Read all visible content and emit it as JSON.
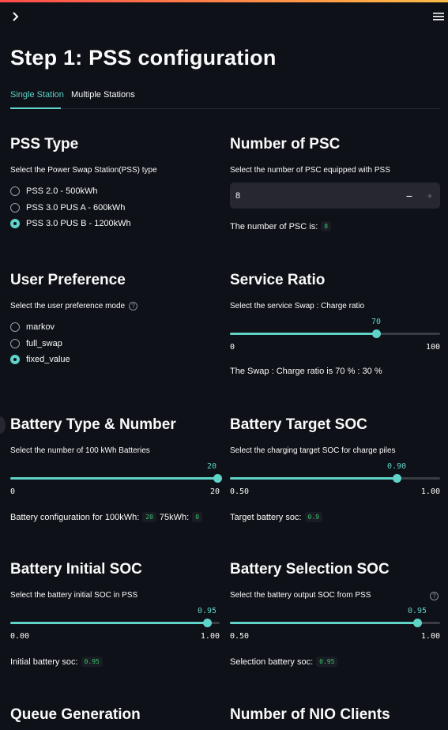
{
  "page_title": "Step 1: PSS configuration",
  "tabs": [
    {
      "label": "Single Station",
      "active": true
    },
    {
      "label": "Multiple Stations",
      "active": false
    }
  ],
  "pss_type": {
    "title": "PSS Type",
    "desc": "Select the Power Swap Station(PSS) type",
    "options": [
      "PSS 2.0 - 500kWh",
      "PSS 3.0 PUS A - 600kWh",
      "PSS 3.0 PUS B - 1200kWh"
    ],
    "selected": 2
  },
  "psc": {
    "title": "Number of PSC",
    "desc": "Select the number of PSC equipped with PSS",
    "value": "8",
    "minus": "−",
    "plus": "+",
    "result_label": "The number of PSC is:",
    "result_value": "8"
  },
  "user_pref": {
    "title": "User Preference",
    "desc": "Select the user preference mode",
    "help": "?",
    "options": [
      "markov",
      "full_swap",
      "fixed_value"
    ],
    "selected": 2
  },
  "service_ratio": {
    "title": "Service Ratio",
    "desc": "Select the service Swap : Charge ratio",
    "value": 70,
    "value_label": "70",
    "min": "0",
    "max": "100",
    "result": "The Swap : Charge ratio is 70 % : 30 %"
  },
  "battery_type": {
    "title": "Battery Type & Number",
    "desc": "Select the number of 100 kWh Batteries",
    "value": 20,
    "value_label": "20",
    "min": "0",
    "max": "20",
    "result_label1": "Battery configuration for 100kWh:",
    "result_value1": "20",
    "result_label2": "75kWh:",
    "result_value2": "0"
  },
  "target_soc": {
    "title": "Battery Target SOC",
    "desc": "Select the charging target SOC for charge piles",
    "value": 0.9,
    "value_label": "0.90",
    "min": "0.50",
    "max": "1.00",
    "result_label": "Target battery soc:",
    "result_value": "0.9"
  },
  "initial_soc": {
    "title": "Battery Initial SOC",
    "desc": "Select the battery initial SOC in PSS",
    "value": 0.95,
    "value_label": "0.95",
    "min": "0.00",
    "max": "1.00",
    "result_label": "Initial battery soc:",
    "result_value": "0.95"
  },
  "selection_soc": {
    "title": "Battery Selection SOC",
    "desc": "Select the battery output SOC from PSS",
    "help": "?",
    "value": 0.95,
    "value_label": "0.95",
    "min": "0.50",
    "max": "1.00",
    "result_label": "Selection battery soc:",
    "result_value": "0.95"
  },
  "queue_generation": {
    "title": "Queue Generation"
  },
  "nio_clients": {
    "title": "Number of NIO Clients"
  },
  "colors": {
    "accent": "#5fd3c8",
    "background": "#0e1117",
    "input_bg": "#262730",
    "code_green": "#39c26d"
  },
  "icons": {
    "sidebar_toggle": "chevron-right-icon",
    "menu": "hamburger-menu-icon"
  }
}
